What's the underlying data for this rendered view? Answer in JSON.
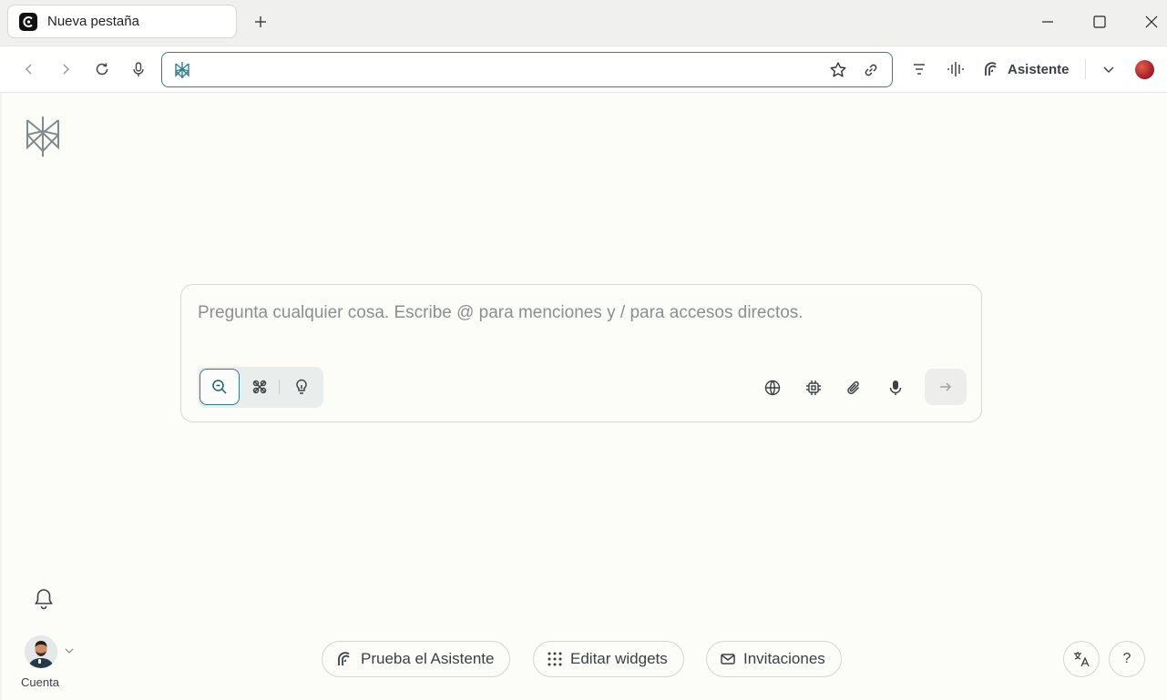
{
  "browser": {
    "tab": {
      "title": "Nueva pestaña",
      "favicon": "perplexity-comet-icon"
    },
    "new_tab_icon": "plus-icon",
    "window_controls": [
      "minimize-icon",
      "maximize-icon",
      "close-icon"
    ],
    "address_bar": {
      "value": "",
      "site_icon": "perplexity-logo-icon"
    },
    "assistant_label": "Asistente",
    "accent_color": "#2c7f8c"
  },
  "composer": {
    "placeholder": "Pregunta cualquier cosa. Escribe @ para menciones y / para accesos directos.",
    "modes": [
      "search-icon",
      "research-icon",
      "labs-bulb-icon"
    ],
    "active_mode": "search-icon",
    "tools": [
      "globe-icon",
      "chip-icon",
      "paperclip-icon",
      "microphone-icon"
    ],
    "send_icon": "arrow-right-icon"
  },
  "sidebar": {
    "account_label": "Cuenta"
  },
  "footer": {
    "buttons": [
      {
        "label": "Prueba el Asistente",
        "icon": "assistant-icon"
      },
      {
        "label": "Editar widgets",
        "icon": "grid-dots-icon"
      },
      {
        "label": "Invitaciones",
        "icon": "mail-icon"
      }
    ],
    "help_label": "?"
  }
}
